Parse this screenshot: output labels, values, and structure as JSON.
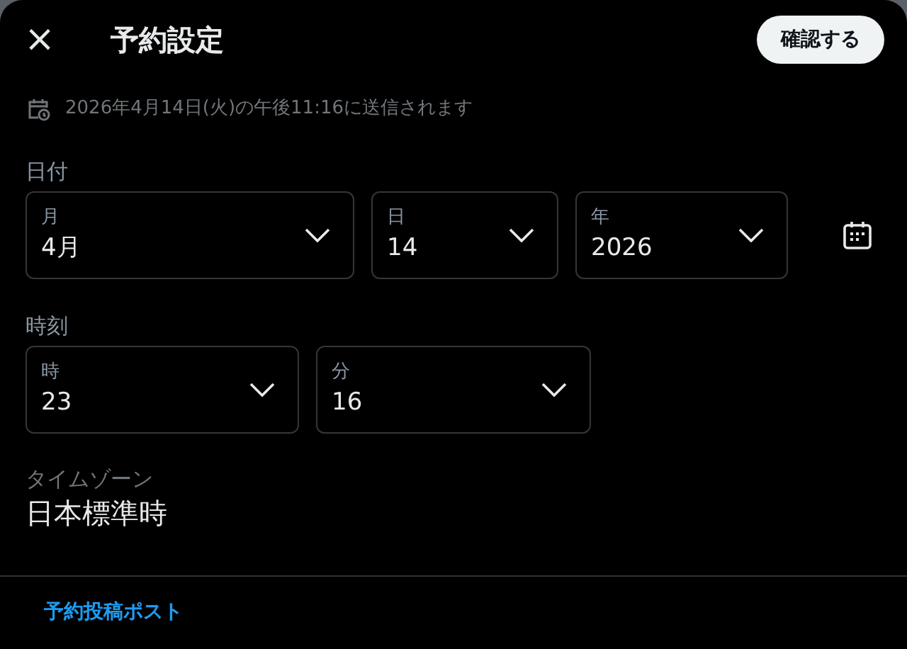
{
  "header": {
    "close": "×",
    "title": "予約設定",
    "confirm_button": "確認する"
  },
  "schedule_info": "2026年4月14日(火)の午後11:16に送信されます",
  "date": {
    "label": "日付",
    "selects": [
      {
        "label": "月",
        "value": "4月"
      },
      {
        "label": "日",
        "value": "14"
      },
      {
        "label": "年",
        "value": "2026"
      }
    ]
  },
  "time": {
    "label": "時刻",
    "selects": [
      {
        "label": "時",
        "value": "23"
      },
      {
        "label": "分",
        "value": "16"
      }
    ]
  },
  "timezone": {
    "label": "タイムゾーン",
    "value": "日本標準時"
  },
  "footer": {
    "link": "予約投稿ポスト"
  }
}
